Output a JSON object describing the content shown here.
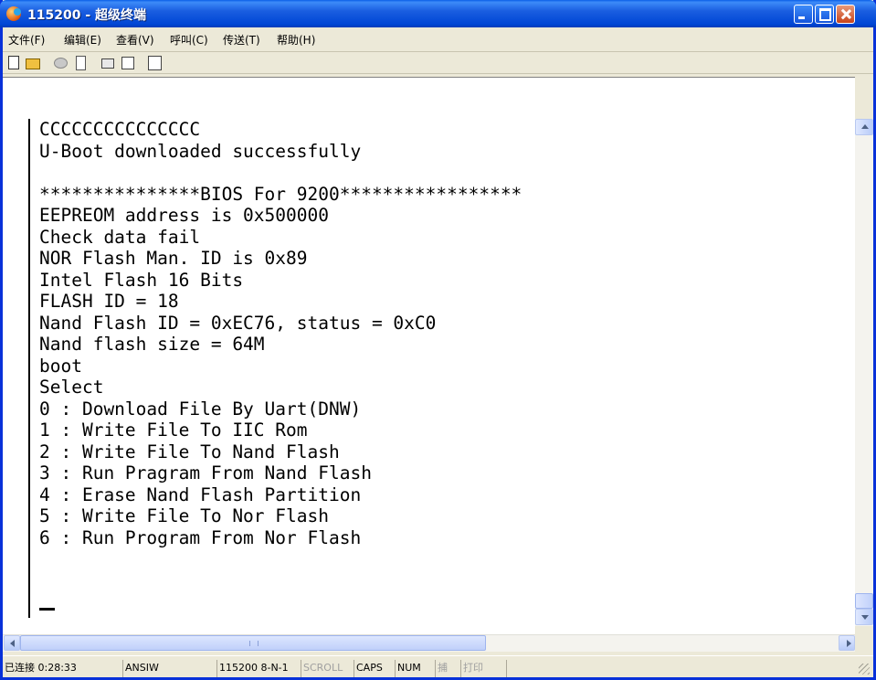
{
  "window": {
    "title": "115200 - 超级终端"
  },
  "menu": [
    "文件(F)",
    "编辑(E)",
    "查看(V)",
    "呼叫(C)",
    "传送(T)",
    "帮助(H)"
  ],
  "toolbar": [
    "new-icon",
    "open-icon",
    "disconnect-icon",
    "dial-icon",
    "send-icon",
    "receive-icon",
    "properties-icon"
  ],
  "terminal": {
    "lines": [
      "CCCCCCCCCCCCCCC",
      "U-Boot downloaded successfully",
      "",
      "***************BIOS For 9200*****************",
      "EEPREOM address is 0x500000",
      "Check data fail",
      "NOR Flash Man. ID is 0x89",
      "Intel Flash 16 Bits",
      "FLASH ID = 18",
      "Nand Flash ID = 0xEC76, status = 0xC0",
      "Nand flash size = 64M",
      "boot",
      "Select",
      "0 : Download File By Uart(DNW)",
      "1 : Write File To IIC Rom",
      "2 : Write File To Nand Flash",
      "3 : Run Pragram From Nand Flash",
      "4 : Erase Nand Flash Partition",
      "5 : Write File To Nor Flash",
      "6 : Run Program From Nor Flash"
    ],
    "text": "CCCCCCCCCCCCCCC\nU-Boot downloaded successfully\n\n***************BIOS For 9200*****************\nEEPREOM address is 0x500000\nCheck data fail\nNOR Flash Man. ID is 0x89\nIntel Flash 16 Bits\nFLASH ID = 18\nNand Flash ID = 0xEC76, status = 0xC0\nNand flash size = 64M\nboot\nSelect\n0 : Download File By Uart(DNW)\n1 : Write File To IIC Rom\n2 : Write File To Nand Flash\n3 : Run Pragram From Nand Flash\n4 : Erase Nand Flash Partition\n5 : Write File To Nor Flash\n6 : Run Program From Nor Flash"
  },
  "status": {
    "connected": "已连接 0:28:33",
    "emulation": "ANSIW",
    "port": "115200 8-N-1",
    "scroll": "SCROLL",
    "caps": "CAPS",
    "num": "NUM",
    "capture": "捕",
    "print": "打印"
  }
}
